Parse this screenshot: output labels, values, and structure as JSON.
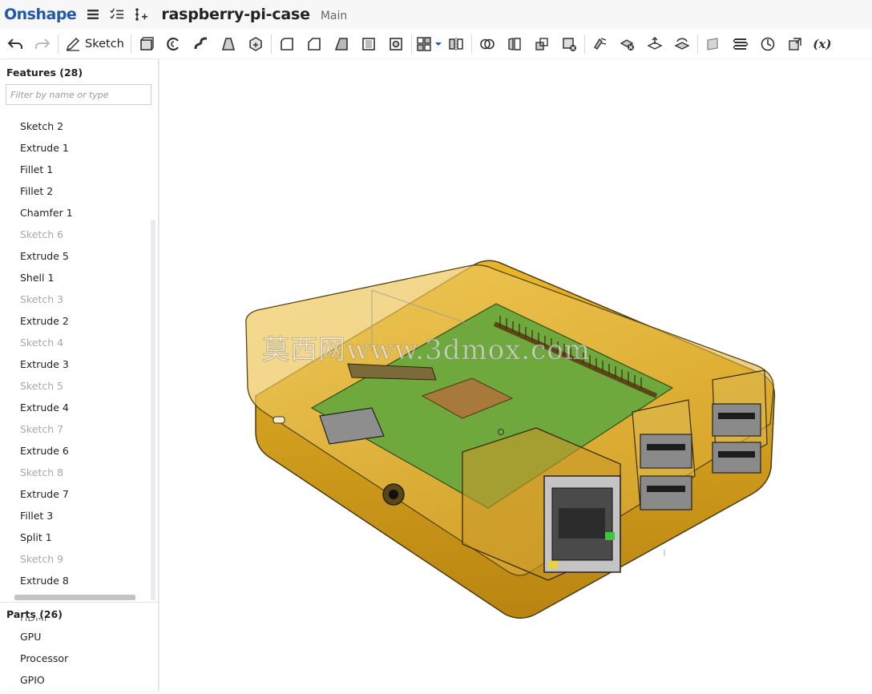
{
  "app": {
    "logo": "Onshape"
  },
  "document": {
    "title": "raspberry-pi-case",
    "branch": "Main"
  },
  "toolbar": {
    "undo": "undo-icon",
    "redo": "redo-icon",
    "sketch_label": "Sketch",
    "variable_label": "(x)"
  },
  "features_panel": {
    "header": "Features (28)",
    "filter_placeholder": "Filter by name or type",
    "items": [
      {
        "label": "Sketch 2",
        "suppressed": false
      },
      {
        "label": "Extrude 1",
        "suppressed": false
      },
      {
        "label": "Fillet 1",
        "suppressed": false
      },
      {
        "label": "Fillet 2",
        "suppressed": false
      },
      {
        "label": "Chamfer 1",
        "suppressed": false
      },
      {
        "label": "Sketch 6",
        "suppressed": true
      },
      {
        "label": "Extrude 5",
        "suppressed": false
      },
      {
        "label": "Shell 1",
        "suppressed": false
      },
      {
        "label": "Sketch 3",
        "suppressed": true
      },
      {
        "label": "Extrude 2",
        "suppressed": false
      },
      {
        "label": "Sketch 4",
        "suppressed": true
      },
      {
        "label": "Extrude 3",
        "suppressed": false
      },
      {
        "label": "Sketch 5",
        "suppressed": true
      },
      {
        "label": "Extrude 4",
        "suppressed": false
      },
      {
        "label": "Sketch 7",
        "suppressed": true
      },
      {
        "label": "Extrude 6",
        "suppressed": false
      },
      {
        "label": "Sketch 8",
        "suppressed": true
      },
      {
        "label": "Extrude 7",
        "suppressed": false
      },
      {
        "label": "Fillet 3",
        "suppressed": false
      },
      {
        "label": "Split 1",
        "suppressed": false
      },
      {
        "label": "Sketch 9",
        "suppressed": true
      },
      {
        "label": "Extrude 8",
        "suppressed": false
      }
    ]
  },
  "parts_panel": {
    "header": "Parts (26)",
    "items": [
      "HDMI",
      "GPU",
      "Processor",
      "GPIO"
    ]
  },
  "viewport": {
    "watermark": "莫西网www.3dmox.com"
  },
  "colors": {
    "brand": "#1f5aa8",
    "case_gold": "#d9a21b",
    "board_green": "#6fa83c",
    "suppressed_text": "#a8a8a8"
  }
}
